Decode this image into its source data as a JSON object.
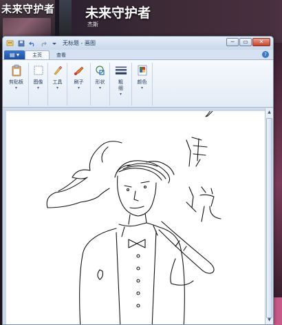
{
  "background": {
    "left_title": "未来守护者",
    "top_title": "未来守护者",
    "top_subtitle": "杰斯"
  },
  "window": {
    "title": "无标题 - 画图",
    "controls": {
      "minimize": "─",
      "maximize": "▭",
      "close": "✕"
    }
  },
  "tabs": {
    "file": "▤ ▾",
    "home": "主页",
    "view": "查看",
    "help": "?"
  },
  "ribbon": {
    "groups": [
      {
        "label": "剪贴板",
        "icon": "clipboard-icon"
      },
      {
        "label": "图像",
        "icon": "image-icon"
      },
      {
        "label": "工具",
        "icon": "tools-icon"
      },
      {
        "label": "刷子",
        "icon": "brush-icon"
      },
      {
        "label": "形状",
        "icon": "shapes-icon"
      },
      {
        "label": "粗细",
        "icon": "size-icon"
      },
      {
        "label": "颜色",
        "icon": "colors-icon"
      }
    ]
  },
  "canvas": {
    "handwriting": "传说"
  },
  "colors": {
    "accent": "#1e4f9e",
    "ribbon_bg": "#e2ebf6",
    "canvas_bg": "#ffffff"
  }
}
